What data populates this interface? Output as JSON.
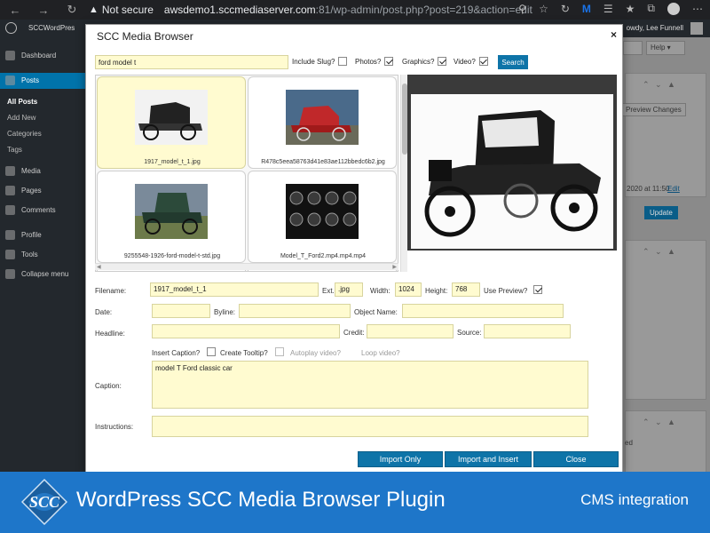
{
  "browser": {
    "security_label": "Not secure",
    "url_host": "awsdemo1.sccmediaserver.com",
    "url_path": ":81/wp-admin/post.php?post=219&action=edit",
    "ext_label": "M"
  },
  "adminbar": {
    "site_name": "SCCWordPres",
    "howdy": "owdy, Lee Funnell"
  },
  "sidemenu": {
    "items": [
      {
        "label": "Dashboard"
      },
      {
        "label": "Posts"
      },
      {
        "label": "Media"
      },
      {
        "label": "Pages"
      },
      {
        "label": "Comments"
      },
      {
        "label": "Profile"
      },
      {
        "label": "Tools"
      },
      {
        "label": "Collapse menu"
      }
    ],
    "subitems": [
      "All Posts",
      "Add New",
      "Categories",
      "Tags"
    ]
  },
  "bgpanel": {
    "help_label": "Help",
    "preview_changes": "Preview Changes",
    "date_text": "2020 at 11:50",
    "edit_link": "Edit",
    "update_label": "Update",
    "ed_text": "ed"
  },
  "modal": {
    "title": "SCC Media Browser",
    "close": "×",
    "search_value": "ford model t",
    "options": {
      "include_slug": "Include Slug?",
      "photos": "Photos?",
      "graphics": "Graphics?",
      "video": "Video?"
    },
    "search_button": "Search",
    "results": [
      {
        "caption": "1917_model_t_1.jpg"
      },
      {
        "caption": "R478c5eea58763d41e83ae112bbedc6b2.jpg"
      },
      {
        "caption": "9255548-1926-ford-model-t-std.jpg"
      },
      {
        "caption": "Model_T_Ford2.mp4.mp4.mp4"
      }
    ],
    "form": {
      "filename_label": "Filename:",
      "filename_value": "1917_model_t_1",
      "ext_label": "Ext.",
      "ext_value": ".jpg",
      "width_label": "Width:",
      "width_value": "1024",
      "height_label": "Height:",
      "height_value": "768",
      "use_preview_label": "Use Preview?",
      "date_label": "Date:",
      "byline_label": "Byline:",
      "object_name_label": "Object Name:",
      "headline_label": "Headline:",
      "credit_label": "Credit:",
      "source_label": "Source:",
      "insert_caption_label": "Insert Caption?",
      "create_tooltip_label": "Create Tooltip?",
      "autoplay_label": "Autoplay video?",
      "loop_label": "Loop video?",
      "caption_label": "Caption:",
      "caption_value": "model T Ford classic car",
      "instructions_label": "Instructions:"
    },
    "buttons": {
      "import_only": "Import Only",
      "import_insert": "Import and Insert",
      "close": "Close"
    }
  },
  "banner": {
    "logo_text": "SCC",
    "title": "WordPress SCC Media Browser Plugin",
    "subtitle": "CMS integration"
  },
  "colors": {
    "accent": "#0e74a8",
    "field_bg": "#fffbd0",
    "banner": "#1e76c9",
    "wp_dark": "#23282d"
  }
}
